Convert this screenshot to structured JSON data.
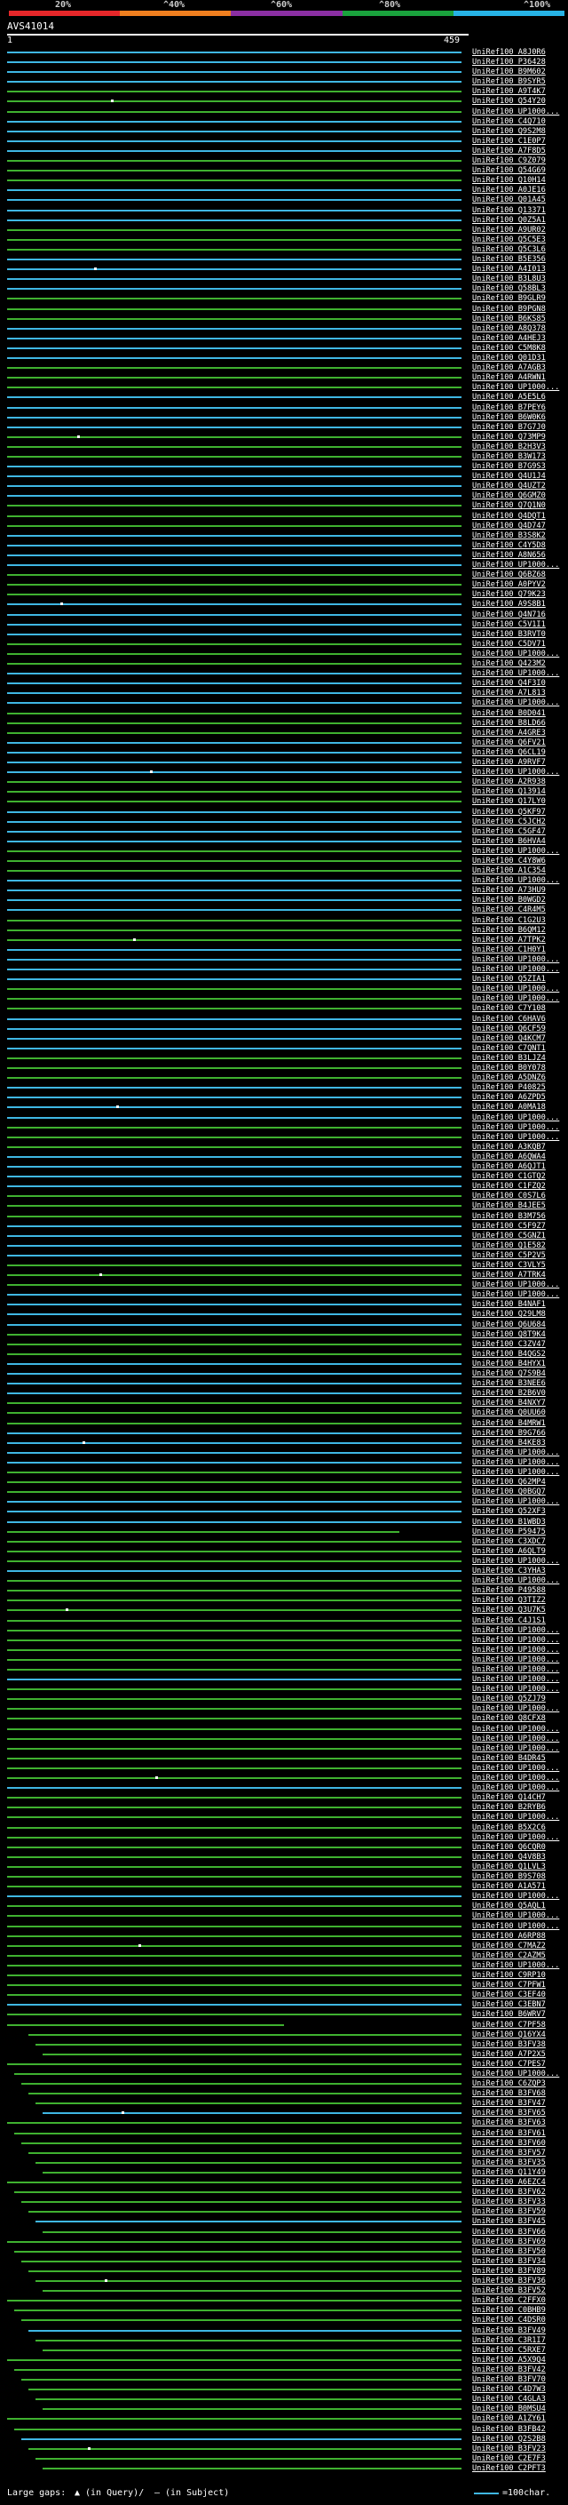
{
  "scale": {
    "labels": [
      "20%",
      "^40%",
      "^60%",
      "^80%",
      "^100%"
    ],
    "colors": [
      "#e6272a",
      "#e6272a",
      "#f07f1f",
      "#f07f1f",
      "#8b2fa3",
      "#8b2fa3",
      "#1aa33d",
      "#1aa33d",
      "#27b3e6",
      "#27b3e6"
    ]
  },
  "query": {
    "id": "AVS41014",
    "start": "1",
    "end": "459"
  },
  "colors": {
    "high": "#3fb7e3",
    "mid": "#3fb130",
    "gap": "#ffffff"
  },
  "legend": {
    "large_gaps": "Large gaps:",
    "in_query": "(in Query)/",
    "in_subject": "(in Subject)",
    "scale_note": "=100char."
  },
  "hits": [
    "UniRef100_A8J0R6",
    "UniRef100_P36428",
    "UniRef100_B9M602",
    "UniRef100_B9SYR5",
    "UniRef100_A9T4K7",
    "UniRef100_Q54Y20",
    "UniRef100_UP1000...",
    "UniRef100_C4Q710",
    "UniRef100_Q9S2M8",
    "UniRef100_C1E0P7",
    "UniRef100_A7F8D5",
    "UniRef100_C9Z079",
    "UniRef100_Q54G69",
    "UniRef100_Q10H14",
    "UniRef100_A0JE16",
    "UniRef100_Q01A45",
    "UniRef100_Q13371",
    "UniRef100_Q0Z5A1",
    "UniRef100_A9UR02",
    "UniRef100_Q5C5E3",
    "UniRef100_Q5C3L6",
    "UniRef100_B5E356",
    "UniRef100_A4I013",
    "UniRef100_B3L8U3",
    "UniRef100_Q58BL3",
    "UniRef100_B9GLR9",
    "UniRef100_B9PGN8",
    "UniRef100_B6KS85",
    "UniRef100_A8Q378",
    "UniRef100_A4HEJ3",
    "UniRef100_C5M8K8",
    "UniRef100_Q01D31",
    "UniRef100_A7AGB3",
    "UniRef100_A4RWN1",
    "UniRef100_UP1000...",
    "UniRef100_A5E5L6",
    "UniRef100_B7PEY6",
    "UniRef100_B6W0K6",
    "UniRef100_B7G7J0",
    "UniRef100_Q73MP9",
    "UniRef100_B2H3V3",
    "UniRef100_B3W173",
    "UniRef100_B7G9S3",
    "UniRef100_Q4U1J4",
    "UniRef100_Q4UZT2",
    "UniRef100_Q6GMZ0",
    "UniRef100_Q7Q1N0",
    "UniRef100_Q4DQT1",
    "UniRef100_Q4D747",
    "UniRef100_B3S8K2",
    "UniRef100_C4Y5D8",
    "UniRef100_A8N656",
    "UniRef100_UP1000...",
    "UniRef100_Q6BZ68",
    "UniRef100_A0PYV2",
    "UniRef100_Q79K23",
    "UniRef100_A9S8B1",
    "UniRef100_Q4N716",
    "UniRef100_C5V1I1",
    "UniRef100_B3RVT0",
    "UniRef100_C5DV71",
    "UniRef100_UP1000...",
    "UniRef100_Q423M2",
    "UniRef100_UP1000...",
    "UniRef100_Q4F3I0",
    "UniRef100_A7L813",
    "UniRef100_UP1000...",
    "UniRef100_B0D041",
    "UniRef100_B8LD66",
    "UniRef100_A4GRE3",
    "UniRef100_Q6FV21",
    "UniRef100_Q6CL19",
    "UniRef100_A9RVF7",
    "UniRef100_UP1000...",
    "UniRef100_A2R938",
    "UniRef100_Q13914",
    "UniRef100_Q17LY0",
    "UniRef100_Q5KF97",
    "UniRef100_C5JCH2",
    "UniRef100_C5GF47",
    "UniRef100_B6HVA4",
    "UniRef100_UP1000...",
    "UniRef100_C4Y8W6",
    "UniRef100_A1C354",
    "UniRef100_UP1000...",
    "UniRef100_A73HU9",
    "UniRef100_B0WGD2",
    "UniRef100_C4R4M5",
    "UniRef100_C1G2U3",
    "UniRef100_B6QM12",
    "UniRef100_A7TPK2",
    "UniRef100_C1H0Y1",
    "UniRef100_UP1000...",
    "UniRef100_UP1000...",
    "UniRef100_Q5ZIA1",
    "UniRef100_UP1000...",
    "UniRef100_UP1000...",
    "UniRef100_C7Y108",
    "UniRef100_C6HAV6",
    "UniRef100_Q6CF59",
    "UniRef100_Q4KCM7",
    "UniRef100_C7QNT1",
    "UniRef100_B3LJZ4",
    "UniRef100_B0Y078",
    "UniRef100_A5DNZ6",
    "UniRef100_P40825",
    "UniRef100_A6ZPD5",
    "UniRef100_A0MA18",
    "UniRef100_UP1000...",
    "UniRef100_UP1000...",
    "UniRef100_UP1000...",
    "UniRef100_A3KQB7",
    "UniRef100_A6QWA4",
    "UniRef100_A6QJT1",
    "UniRef100_C1GTQ2",
    "UniRef100_C1FZQ2",
    "UniRef100_C0S7L6",
    "UniRef100_B4JEE5",
    "UniRef100_B3M756",
    "UniRef100_C5F9Z7",
    "UniRef100_C5GNZ1",
    "UniRef100_Q1E582",
    "UniRef100_C5P2V5",
    "UniRef100_C3VLY5",
    "UniRef100_A7TRK4",
    "UniRef100_UP1000...",
    "UniRef100_UP1000...",
    "UniRef100_B4NAF1",
    "UniRef100_Q29LM8",
    "UniRef100_Q6U684",
    "UniRef100_Q8T9K4",
    "UniRef100_C3ZV47",
    "UniRef100_B4QGS2",
    "UniRef100_B4HYX1",
    "UniRef100_Q7S9B4",
    "UniRef100_B3NEE6",
    "UniRef100_B2B6V0",
    "UniRef100_B4NXY7",
    "UniRef100_Q0UU60",
    "UniRef100_B4MRW1",
    "UniRef100_B9G766",
    "UniRef100_B4KE83",
    "UniRef100_UP1000...",
    "UniRef100_UP1000...",
    "UniRef100_UP1000...",
    "UniRef100_Q62MP4",
    "UniRef100_Q0BGQ7",
    "UniRef100_UP1000...",
    "UniRef100_Q52XF3",
    "UniRef100_B1WBD3",
    "UniRef100_P59475",
    "UniRef100_C3XDC7",
    "UniRef100_A6QLT9",
    "UniRef100_UP1000...",
    "UniRef100_C3YHA3",
    "UniRef100_UP1000...",
    "UniRef100_P49588",
    "UniRef100_Q3TIZ2",
    "UniRef100_Q3U7K5",
    "UniRef100_C4J1S1",
    "UniRef100_UP1000...",
    "UniRef100_UP1000...",
    "UniRef100_UP1000...",
    "UniRef100_UP1000...",
    "UniRef100_UP1000...",
    "UniRef100_UP1000...",
    "UniRef100_UP1000...",
    "UniRef100_Q5ZJ79",
    "UniRef100_UP1000...",
    "UniRef100_Q8CFX8",
    "UniRef100_UP1000...",
    "UniRef100_UP1000...",
    "UniRef100_UP1000...",
    "UniRef100_B4DR45",
    "UniRef100_UP1000...",
    "UniRef100_UP1000...",
    "UniRef100_UP1000...",
    "UniRef100_Q14CH7",
    "UniRef100_B2RYB6",
    "UniRef100_UP1000...",
    "UniRef100_B5X2C6",
    "UniRef100_UP1000...",
    "UniRef100_Q6CQR0",
    "UniRef100_Q4V8B3",
    "UniRef100_Q1LVL3",
    "UniRef100_B9S708",
    "UniRef100_A1A571",
    "UniRef100_UP1000...",
    "UniRef100_Q5AQL1",
    "UniRef100_UP1000...",
    "UniRef100_UP1000...",
    "UniRef100_A6RP88",
    "UniRef100_C7MAZ2",
    "UniRef100_C2AZM5",
    "UniRef100_UP1000...",
    "UniRef100_C9RP10",
    "UniRef100_C7PFW1",
    "UniRef100_C3EF40",
    "UniRef100_C3EBN7",
    "UniRef100_B6WRV7",
    "UniRef100_C7PF58",
    "UniRef100_Q16YX4",
    "UniRef100_B3FV38",
    "UniRef100_A7P2X5",
    "UniRef100_C7PES7",
    "UniRef100_UP1000...",
    "UniRef100_C6ZQP3",
    "UniRef100_B3FV68",
    "UniRef100_B3FV47",
    "UniRef100_B3FV65",
    "UniRef100_B3FV63",
    "UniRef100_B3FV61",
    "UniRef100_B3FV60",
    "UniRef100_B3FV57",
    "UniRef100_B3FV35",
    "UniRef100_Q11Y49",
    "UniRef100_A6EZC4",
    "UniRef100_B3FV62",
    "UniRef100_B3FV33",
    "UniRef100_B3FV59",
    "UniRef100_B3FV45",
    "UniRef100_B3FV66",
    "UniRef100_B3FV69",
    "UniRef100_B3FV50",
    "UniRef100_B3FV34",
    "UniRef100_B3FV89",
    "UniRef100_B3FV36",
    "UniRef100_B3FV52",
    "UniRef100_C2FFX0",
    "UniRef100_C0BHB9",
    "UniRef100_C4DSR0",
    "UniRef100_B3FV49",
    "UniRef100_C3R1I7",
    "UniRef100_C5RXE7",
    "UniRef100_A5X9Q4",
    "UniRef100_B3FV42",
    "UniRef100_B3FV70",
    "UniRef100_C4D7W3",
    "UniRef100_C4GLA3",
    "UniRef100_B0MSU4",
    "UniRef100_A1ZY61",
    "UniRef100_B3FB42",
    "UniRef100_Q2S2B8",
    "UniRef100_B3FV23",
    "UniRef100_C2E7F3",
    "UniRef100_C2PFT3"
  ]
}
